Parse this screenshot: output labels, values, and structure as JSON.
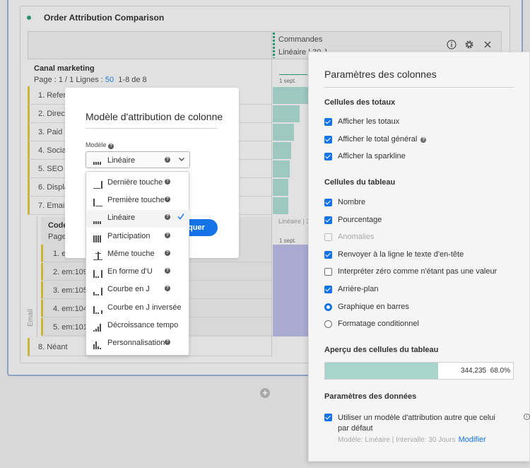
{
  "background": {
    "title": "Order Attribution Comparison",
    "column_header_1": "Commandes",
    "column_header_2": "Linéaire | 30 J",
    "row_dimension": "Canal marketing",
    "pager_prefix": "Page : 1 / 1 Lignes :",
    "pager_count": "50",
    "pager_range": "1-8 de 8",
    "sparkline_date": "1 sept.",
    "rows": [
      "1. Referr",
      "2. Direct",
      "3. Paid S",
      "4. Social",
      "5. SEO",
      "6. Displa",
      "7. Email"
    ],
    "sub_dimension": "Code",
    "sub_pager": "Page",
    "sub_sparkline_label": "Linéaire | 30",
    "sub_date": "1 sept.",
    "sub_rows": [
      "1. em",
      "2. em:109",
      "3. em:105",
      "4. em:104",
      "5. em:101"
    ],
    "sub_side_label": "Email",
    "last_row": "8. Néant",
    "apply_partial": "liquer",
    "add_symbol": "+",
    "accent_colors": {
      "green": "#2d9d78",
      "teal_bar": "#a7d5cc",
      "purple_bar": "#b5b4dd",
      "gold": "#d6c13a",
      "blue": "#1473e6"
    }
  },
  "header_icons": [
    "info-icon",
    "gear-icon",
    "close-icon"
  ],
  "modal": {
    "title": "Modèle d'attribution de colonne",
    "field_label": "Modèle",
    "selected_value": "Linéaire",
    "options": [
      {
        "label": "Dernière touche",
        "icon": "last-touch-icon",
        "selected": false
      },
      {
        "label": "Première touche",
        "icon": "first-touch-icon",
        "selected": false
      },
      {
        "label": "Linéaire",
        "icon": "linear-icon",
        "selected": true
      },
      {
        "label": "Participation",
        "icon": "participation-icon",
        "selected": false
      },
      {
        "label": "Même touche",
        "icon": "same-touch-icon",
        "selected": false
      },
      {
        "label": "En forme d'U",
        "icon": "u-shaped-icon",
        "selected": false
      },
      {
        "label": "Courbe en J",
        "icon": "j-curve-icon",
        "selected": false
      },
      {
        "label": "Courbe en J inversée",
        "icon": "inverse-j-icon",
        "selected": false
      },
      {
        "label": "Décroissance tempo",
        "icon": "time-decay-icon",
        "selected": false
      },
      {
        "label": "Personnalisation",
        "icon": "custom-icon",
        "selected": false
      }
    ]
  },
  "settings": {
    "title": "Paramètres des colonnes",
    "totals_section": "Cellules des totaux",
    "totals_options": [
      {
        "label": "Afficher les totaux",
        "checked": true,
        "info": false
      },
      {
        "label": "Afficher le total général",
        "checked": true,
        "info": true
      },
      {
        "label": "Afficher la sparkline",
        "checked": true,
        "info": false
      }
    ],
    "table_section": "Cellules du tableau",
    "table_options": [
      {
        "label": "Nombre",
        "type": "checkbox",
        "state": "checked"
      },
      {
        "label": "Pourcentage",
        "type": "checkbox",
        "state": "checked"
      },
      {
        "label": "Anomalies",
        "type": "checkbox",
        "state": "disabled"
      },
      {
        "label": "Renvoyer à la ligne le texte d'en-tête",
        "type": "checkbox",
        "state": "checked"
      },
      {
        "label": "Interpréter zéro comme n'étant pas une valeur",
        "type": "checkbox",
        "state": "unchecked"
      },
      {
        "label": "Arrière-plan",
        "type": "checkbox",
        "state": "checked"
      },
      {
        "label": "Graphique en barres",
        "type": "radio",
        "state": "on"
      },
      {
        "label": "Formatage conditionnel",
        "type": "radio",
        "state": "off"
      }
    ],
    "preview_section": "Aperçu des cellules du tableau",
    "preview_value": "344,235",
    "preview_percent": "68.0%",
    "preview_fill_fraction": 0.6,
    "data_section": "Paramètres des données",
    "data_option": "Utiliser un modèle d'attribution autre que celui par défaut",
    "model_line": "Modèle: Linéaire | Intervalle: 30 Jours",
    "modify_link": "Modifier"
  }
}
